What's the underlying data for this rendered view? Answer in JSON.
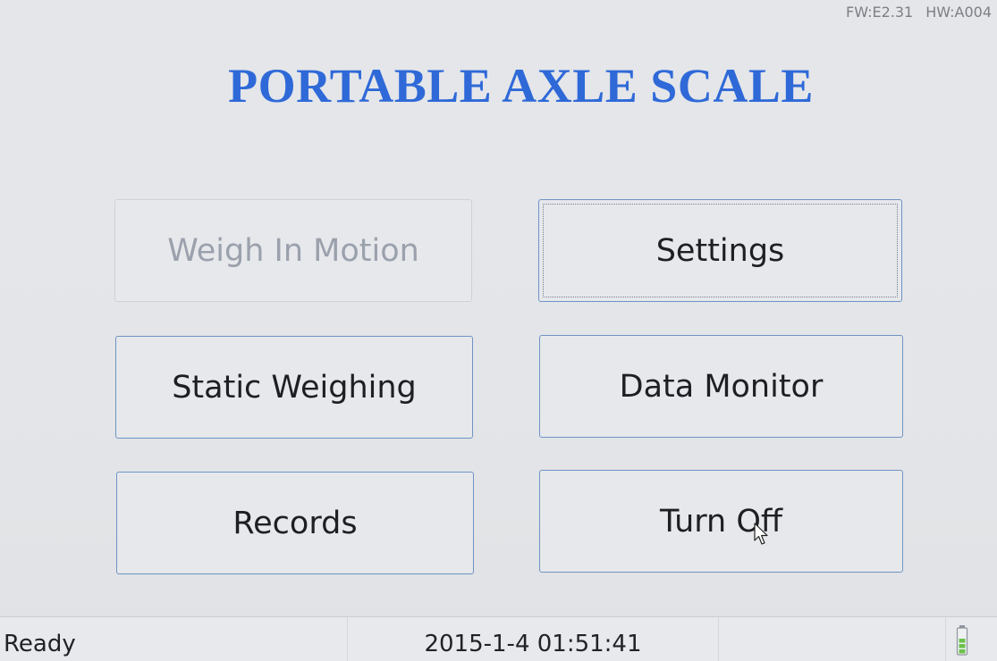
{
  "header": {
    "firmware": "FW:E2.31",
    "hardware": "HW:A004",
    "title": "PORTABLE AXLE SCALE"
  },
  "menu": {
    "weigh_in_motion": {
      "label": "Weigh In Motion",
      "enabled": false
    },
    "settings": {
      "label": "Settings",
      "focused": true
    },
    "static_weighing": {
      "label": "Static Weighing"
    },
    "data_monitor": {
      "label": "Data Monitor"
    },
    "records": {
      "label": "Records"
    },
    "turn_off": {
      "label": "Turn Off"
    }
  },
  "status_bar": {
    "state": "Ready",
    "datetime": "2015-1-4 01:51:41",
    "battery_icon": "battery-icon"
  },
  "colors": {
    "title": "#2f69d8",
    "button_border": "#6f93c5",
    "background": "#e4e6ea",
    "battery": "#6cc24a"
  }
}
